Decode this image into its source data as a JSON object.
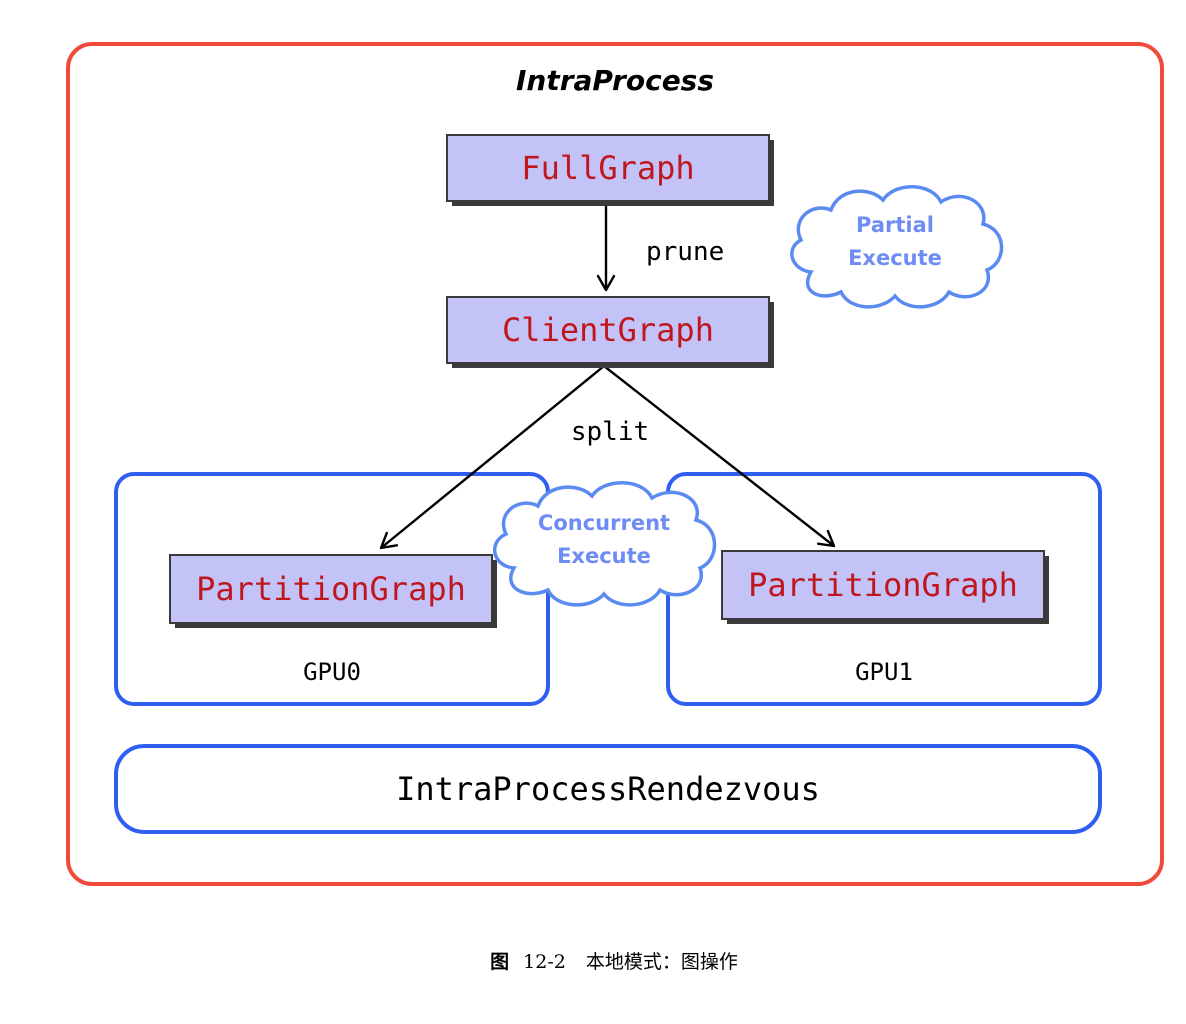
{
  "title": "IntraProcess",
  "nodes": {
    "full_graph": "FullGraph",
    "client_graph": "ClientGraph",
    "partition_left": "PartitionGraph",
    "partition_right": "PartitionGraph"
  },
  "edges": {
    "prune": "prune",
    "split": "split"
  },
  "clouds": {
    "partial": {
      "line1": "Partial",
      "line2": "Execute"
    },
    "concurrent": {
      "line1": "Concurrent",
      "line2": "Execute"
    }
  },
  "devices": {
    "gpu0": "GPU0",
    "gpu1": "GPU1"
  },
  "rendezvous": "IntraProcessRendezvous",
  "caption": {
    "prefix": "图",
    "number": "12-2",
    "text": "本地模式：图操作"
  },
  "colors": {
    "outer_border": "#f04a3c",
    "device_border": "#2f5ff0",
    "node_fill": "#c3c3f7",
    "node_text": "#c0171f",
    "cloud_text": "#6f8cf5",
    "cloud_border": "#5b8bf0"
  }
}
